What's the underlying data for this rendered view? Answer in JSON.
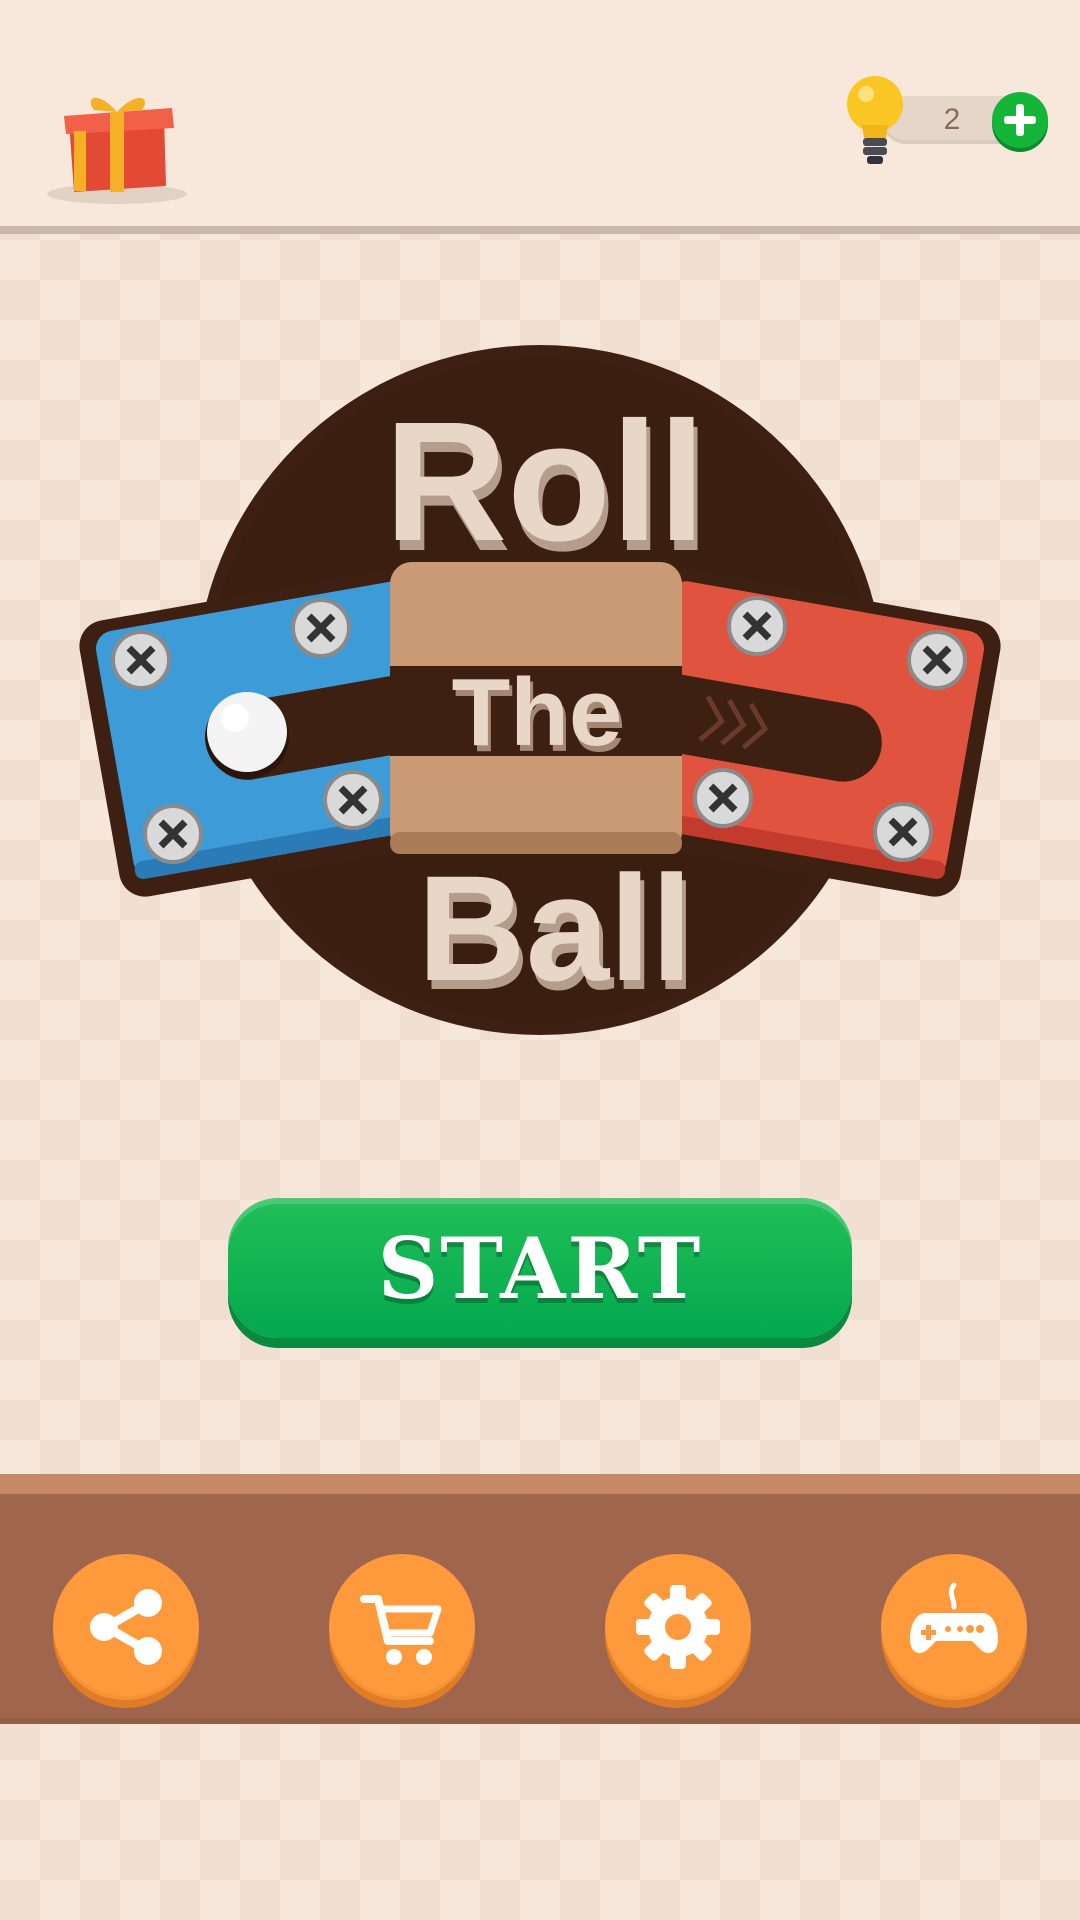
{
  "header": {
    "gift_icon": "gift-box-icon",
    "hint_icon": "lightbulb-icon",
    "hint_count": "2",
    "add_icon": "plus-icon"
  },
  "logo": {
    "word_top": "Roll",
    "word_middle": "The",
    "word_bottom": "Ball",
    "colors": {
      "blue": "#3d9bd8",
      "red": "#e0533f",
      "wood": "#c99a74",
      "dark": "#3e2012"
    }
  },
  "start": {
    "label": "START",
    "color": "#06a84e"
  },
  "bottom_menu": {
    "items": [
      {
        "icon": "share-icon"
      },
      {
        "icon": "shopping-cart-icon"
      },
      {
        "icon": "gear-icon"
      },
      {
        "icon": "gamepad-icon"
      }
    ],
    "button_color": "#ff9a3c"
  }
}
